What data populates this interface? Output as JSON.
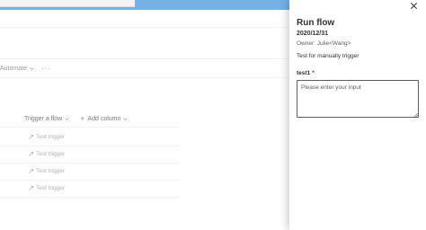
{
  "toolbar": {
    "automate_label": "Automate",
    "more_label": "···"
  },
  "columns": {
    "trigger_label": "Trigger a flow",
    "add_label": "Add column"
  },
  "rows": [
    {
      "link": "Test trigger"
    },
    {
      "link": "Test trigger"
    },
    {
      "link": "Test trigger"
    },
    {
      "link": "Test trigger"
    }
  ],
  "panel": {
    "title": "Run flow",
    "flow_name": "2020/12/31",
    "owner": "Owner: Julie<Wang>",
    "description": "Test for manually trigger",
    "field_label": "test1",
    "required_marker": "*",
    "field_placeholder": "Please enter your input",
    "field_value": ""
  },
  "colors": {
    "accent": "#2b88d8",
    "required": "#a4262c"
  },
  "icons": [
    "chevron-down-icon",
    "more-icon",
    "plus-icon",
    "trigger-link-icon",
    "close-icon"
  ]
}
